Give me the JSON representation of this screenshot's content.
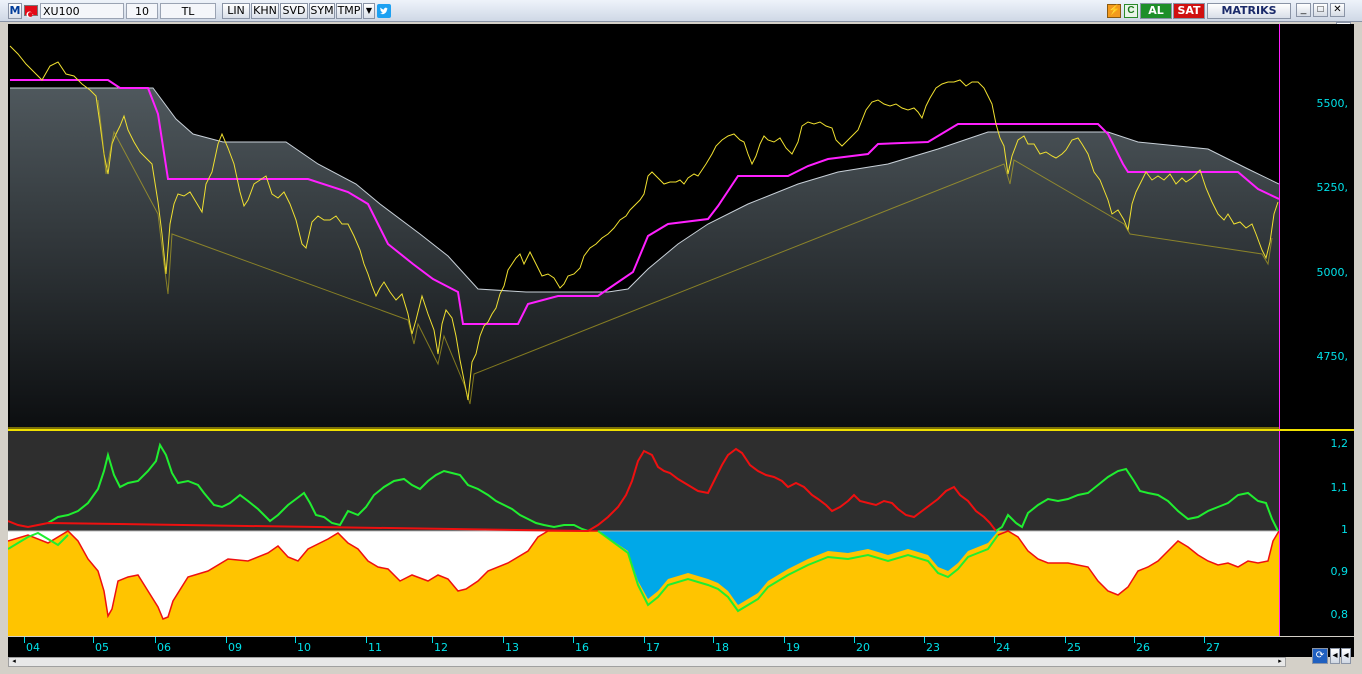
{
  "toolbar": {
    "logo": "M",
    "symbol": "XU100",
    "period": "10",
    "currency": "TL",
    "scale": "LIN",
    "buttons": [
      "KHN",
      "SVD",
      "SYM",
      "TMP"
    ],
    "buy_label": "AL",
    "sell_label": "SAT",
    "brand": "MATRIKS",
    "colors": {
      "buy": "#1e8f2a",
      "sell": "#d01010"
    }
  },
  "main_chart": {
    "y_ticks": [
      "5500,",
      "5250,",
      "5000,",
      "4750,"
    ],
    "colors": {
      "price": "#f0e030",
      "stop_line": "#ff20ff",
      "band": "#4a5258",
      "background": "#000000"
    }
  },
  "lower_chart": {
    "y_ticks": [
      "1,2",
      "1,1",
      "1",
      "0,9",
      "0,8"
    ],
    "colors": {
      "up": "#20ee30",
      "down": "#ee1010",
      "fill_gold": "#ffc400",
      "fill_white": "#ffffff",
      "fill_blue": "#00a8e8",
      "upper_bg": "#303030"
    }
  },
  "x_axis": {
    "labels": [
      "04",
      "05",
      "06",
      "09",
      "10",
      "11",
      "12",
      "13",
      "16",
      "17",
      "18",
      "19",
      "20",
      "23",
      "24",
      "25",
      "26",
      "27"
    ]
  }
}
